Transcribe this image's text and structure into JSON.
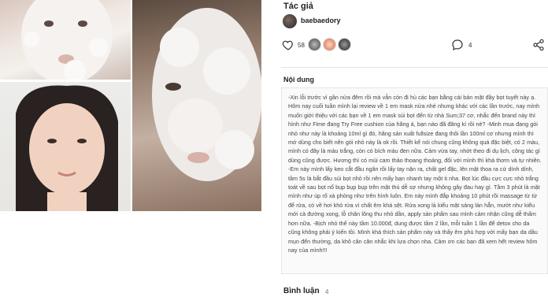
{
  "author": {
    "section_title": "Tác giả",
    "name": "baebaedory"
  },
  "actions": {
    "like_count": "58",
    "comment_count": "4",
    "icons": [
      "heart-icon",
      "comment-icon",
      "share-icon"
    ]
  },
  "content": {
    "section_title": "Nội dung",
    "text": "-Xin lỗi trước vì gần nửa đêm rồi mà vẫn còn đi hù các bạn bằng cái bản mặt đầy bọt tuyết này ạ. Hôm nay cuối tuần mình lại review về 1 em mask nửa nhé nhưng khác với các lần trước, nay mình muốn giới thiệu với các bạn về 1 em mask sủi bọt đến từ nhà Sum;37 cơ, nhắc đến brand này thì hình như Fime đang Try Free cushion của hãng á, bạn nào đã đăng kí rồi nè? -Minh mua đang gói nhỏ như này là khoảng 10ml gì đó, hãng sản xuất fullsize đang thôi lần 100ml cơ nhưng mình thì mớ dùng cho biết nên gói nhỏ này là ok rồi. Thiết kế nói chung cũng không quá đặc biệt, có 2 màu, mình có đây là màu trắng, còn có bích màu đen nữa. Cảm vừa tay, nhớt theo đi dụ lịch, công tác gì dùng cũng được. Hương thì có mùi cam thảo thoang thoảng, đối với mình thì khá thơm và tự nhiên. -Em này mình lấy keo cắt đầu ngân rồi lấy tay nặn ra, chất gel đặc, lên mặt thoa ra cứ dính dính, tầm 5s là bắt đầu sủi bọt nhỏ rồi nên mấy bạn nhanh tay một ti nha. Bọt lúc đầu cực cực nhỏ trắng toát về sau bọt nổ bụp bụp bụp trên mặt thú dễ sợ nhưng không gây đau hay gì. Tầm 3 phút là mặt mình như úp rổ xà phòng như trên hình luôn. Em này mình đắp khoảng 10 phút rồi massage từ từ để rửa, có về hơi khó rửa vì chất êm khá sệt. Rửa xong là kiểu mặt sáng lán hẳn, mướt như kiểu mới cà đường xong, lỗ chân lông thu nhỏ dần, apply sản phẩm sau mình cảm nhận cũng dễ thấm hơn nữa. -Bịch nhỏ thế này tầm 10.000đ, dung được tầm 2 lần, mỗi tuần 1 lần để detox cho da cũng không phải ý kiến tồi. Mình khá thích sản phẩm này và thấy êm phù hợp với mấy bạn da dầu mụn đến thường, da khô cân cân nhắc khi lựa chọn nha. Cảm ơn các bạn đã xem hết review hôm nay của mình!!!"
  },
  "comments": {
    "section_title": "Bình luận",
    "count": "4"
  },
  "colors": {
    "background": "#ffffff",
    "text": "#222222",
    "muted": "#777777",
    "border": "#e6e6e6"
  }
}
